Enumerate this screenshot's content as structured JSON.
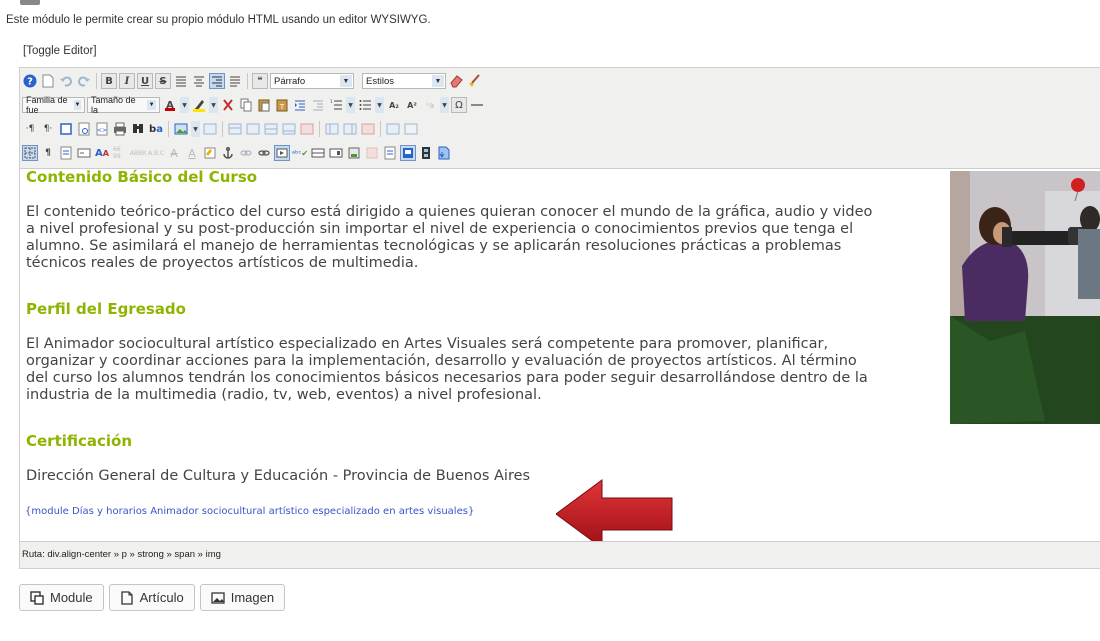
{
  "intro_text": "Este módulo le permite crear su propio módulo HTML usando un editor WYSIWYG.",
  "toggle_editor": "[Toggle Editor]",
  "toolbar": {
    "format_select": "Párrafo",
    "styles_select": "Estilos",
    "font_family": "Familia de fue",
    "font_size": "Tamaño de la",
    "bold": "B",
    "italic": "I",
    "underline": "U",
    "strike": "S",
    "omega": "Ω"
  },
  "content": {
    "heading1": "Contenido Básico del Curso",
    "para1_lines": [
      "El contenido teórico-práctico del curso está dirigido a quienes quieran conocer el mundo de la gráfica, audio y video",
      "a nivel profesional y su post-producción sin importar el nivel de experiencia o conocimientos previos que tenga el",
      "alumno. Se asimilará el manejo de herramientas tecnológicas y se aplicarán resoluciones prácticas a problemas",
      "técnicos reales de proyectos artísticos de multimedia."
    ],
    "heading2": "Perfil del Egresado",
    "para2_lines": [
      "El Animador sociocultural artístico especializado en Artes Visuales será competente para promover, planificar,",
      "organizar y coordinar acciones para la implementación, desarrollo y evaluación de proyectos artísticos. Al término",
      "del curso los alumnos tendrán los conocimientos básicos necesarios para poder seguir desarrollándose dentro de la",
      "industria de la multimedia (radio, tv, web, eventos) a nivel profesional."
    ],
    "heading3": "Certificación",
    "para3": "Dirección General de Cultura y Educación - Provincia de Buenos Aires",
    "module_tag": "{module Días y horarios Animador sociocultural artístico especializado en artes visuales}"
  },
  "path_bar": "Ruta:  div.align-center » p » strong » span » img",
  "buttons": {
    "module": "Module",
    "article": "Artículo",
    "image": "Imagen"
  },
  "colors": {
    "heading": "#8db400",
    "arrow": "#c0161b",
    "toolbar_bg": "#f0f0ee"
  }
}
